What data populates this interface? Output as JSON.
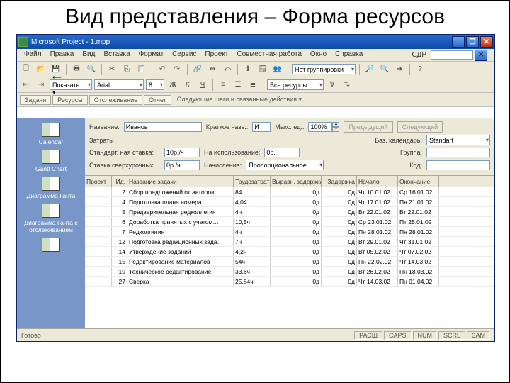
{
  "slide": {
    "title": "Вид представления – Форма ресурсов"
  },
  "window": {
    "title": "Microsoft Project - 1.mpp",
    "min": "_",
    "max": "❐",
    "close": "✕"
  },
  "menu": [
    "Файл",
    "Правка",
    "Вид",
    "Вставка",
    "Формат",
    "Сервис",
    "Проект",
    "Совместная работа",
    "Окно",
    "Справка"
  ],
  "menu_right_label": "СДР",
  "toolbar2": {
    "font": "Arial",
    "nogroup": "Нет группировки",
    "allres": "Все ресурсы"
  },
  "tabs": [
    "Задачи",
    "Ресурсы",
    "Отслеживание",
    "Отчет"
  ],
  "tabs_right": "Следующие шаги и связанные действия ▾",
  "prevnext_label": "⟵ Показать ▾",
  "form": {
    "name_label": "Название:",
    "name_value": "Иванов",
    "short_label": "Краткое назв.:",
    "short_value": "И",
    "max_label": "Макс. ед.:",
    "max_value": "100%",
    "prev_btn": "Предыдущий",
    "next_btn": "Следующий",
    "costs_label": "Затраты",
    "std_label": "Стандарт. ная ставка:",
    "std_value": "10р./ч",
    "peruse_label": "На использование:",
    "peruse_value": "0р.",
    "basecal_label": "Баз. календарь:",
    "basecal_value": "Standart",
    "ovt_label": "Ставка сверхурочных:",
    "ovt_value": "0р./ч",
    "accrue_label": "Начисление:",
    "accrue_value": "Пропорциональное",
    "group_label": "Группа:",
    "code_label": "Код:"
  },
  "grid": {
    "headers": [
      "Проект",
      "Ид.",
      "Название задачи",
      "Трудозатраты",
      "Выравн. задержка",
      "Задержка",
      "Начало",
      "Окончание"
    ],
    "rows": [
      {
        "id": "2",
        "name": "Сбор предложений от авторов",
        "trud": "84",
        "vyr": "0д",
        "zad": "0д",
        "start": "Чт 10.01.02",
        "end": "Ср 16.01.02"
      },
      {
        "id": "4",
        "name": "Подготовка плана номера",
        "trud": "4,04",
        "vyr": "0д",
        "zad": "0д",
        "start": "Чт 17.01.02",
        "end": "Пн 21.01.02"
      },
      {
        "id": "5",
        "name": "Предварительная редколлегия",
        "trud": "4ч",
        "vyr": "0д",
        "zad": "0д",
        "start": "Вт 22.01.02",
        "end": "Вт 22.01.02"
      },
      {
        "id": "6",
        "name": "Доработка принятых с учетом…",
        "trud": "10,5ч",
        "vyr": "0д",
        "zad": "0д",
        "start": "Ср 23.01.02",
        "end": "Пт 25.01.02"
      },
      {
        "id": "7",
        "name": "Редколлегия",
        "trud": "4ч",
        "vyr": "0д",
        "zad": "0д",
        "start": "Пн 28.01.02",
        "end": "Пн 28.01.02"
      },
      {
        "id": "12",
        "name": "Подготовка редакционных зада…",
        "trud": "7ч",
        "vyr": "0д",
        "zad": "0д",
        "start": "Вт 29.01.02",
        "end": "Чт 31.01.02"
      },
      {
        "id": "14",
        "name": "Утверждение заданий",
        "trud": "4,2ч",
        "vyr": "0д",
        "zad": "0д",
        "start": "Вт 05.02.02",
        "end": "Чт 07.02.02"
      },
      {
        "id": "15",
        "name": "Редактирование материалов",
        "trud": "54ч",
        "vyr": "0д",
        "zad": "0д",
        "start": "Пн 22.02.02",
        "end": "Чт 14.03.02"
      },
      {
        "id": "19",
        "name": "Техническое редактирование",
        "trud": "33,6ч",
        "vyr": "0д",
        "zad": "0д",
        "start": "Вт 26.02.02",
        "end": "Пн 18.03.02"
      },
      {
        "id": "27",
        "name": "Сверка",
        "trud": "25,84ч",
        "vyr": "0д",
        "zad": "0д",
        "start": "Чт 14.03.02",
        "end": "Пн 01.04.02"
      }
    ]
  },
  "sidebar": [
    "Calendar",
    "Gantt Chart",
    "Диаграмма Ганта",
    "Диаграмма Ганта с отслеживанием"
  ],
  "status": {
    "ready": "Готово",
    "cells": [
      "РАСШ",
      "CAPS",
      "NUM",
      "SCRL",
      "ЗАМ"
    ]
  }
}
